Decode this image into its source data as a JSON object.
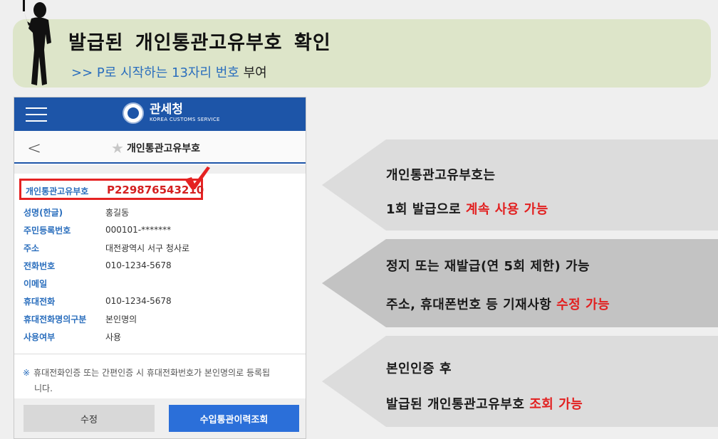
{
  "banner": {
    "title": "발급된 개인통관고유부호 확인",
    "sub_prefix": ">> ",
    "sub_blue": "P로 시작하는 13자리 번호",
    "sub_rest": " 부여"
  },
  "app": {
    "logo_ko": "관세청",
    "logo_en": "KOREA CUSTOMS SERVICE",
    "back_symbol": "<",
    "page_title": "개인통관고유부호"
  },
  "record": {
    "id_label": "개인통관고유부호",
    "id_value": "P229876543210",
    "fields": [
      {
        "label": "성명(한글)",
        "value": "홍길동"
      },
      {
        "label": "주민등록번호",
        "value": "000101-*******"
      },
      {
        "label": "주소",
        "value": "대전광역시 서구 청사로"
      },
      {
        "label": "전화번호",
        "value": "010-1234-5678"
      },
      {
        "label": "이메일",
        "value": ""
      },
      {
        "label": "휴대전화",
        "value": "010-1234-5678"
      },
      {
        "label": "휴대전화명의구분",
        "value": "본인명의"
      },
      {
        "label": "사용여부",
        "value": "사용"
      }
    ]
  },
  "notice": {
    "mark": "※",
    "line1": "휴대전화인증 또는 간편인증 시 휴대전화번호가 본인명의로 등록됩",
    "line2": "니다."
  },
  "buttons": {
    "edit": "수정",
    "history": "수입통관이력조회"
  },
  "callouts": [
    {
      "line1": "개인통관고유부호는",
      "line2_black": "1회 발급으로 ",
      "line2_red": "계속 사용 가능"
    },
    {
      "line1": "정지 또는 재발급(연 5회 제한) 가능",
      "line2_black": "주소, 휴대폰번호 등 기재사항 ",
      "line2_red": "수정 가능"
    },
    {
      "line1": "본인인증 후",
      "line2_black": "발급된 개인통관고유부호 ",
      "line2_red": "조회 가능"
    }
  ],
  "colors": {
    "app_blue": "#1d55a8",
    "label_blue": "#2a6ebd",
    "highlight_red": "#e22020",
    "banner_green": "#dde5c9"
  }
}
